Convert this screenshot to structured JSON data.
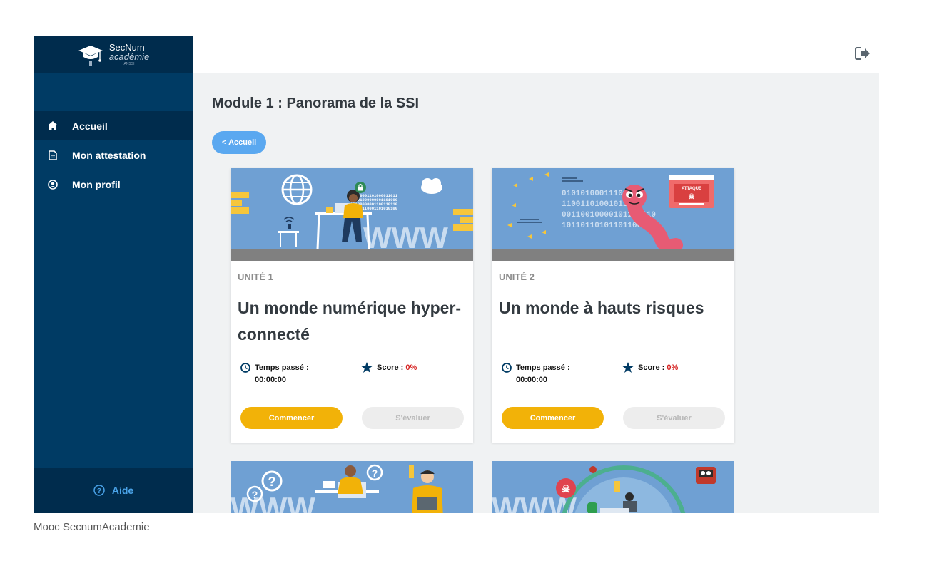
{
  "brand": {
    "line1": "SecNum",
    "line2": "académie",
    "line3": "ANSSI"
  },
  "sidebar": {
    "items": [
      {
        "label": "Accueil",
        "icon": "home-icon",
        "active": true
      },
      {
        "label": "Mon attestation",
        "icon": "document-icon",
        "active": false
      },
      {
        "label": "Mon profil",
        "icon": "user-circle-icon",
        "active": false
      }
    ],
    "help": {
      "label": "Aide",
      "icon": "help-circle-icon"
    }
  },
  "topbar": {
    "logout_icon": "logout-icon"
  },
  "page": {
    "title": "Module 1 : Panorama de la SSI",
    "back_label": "< Accueil"
  },
  "cards": [
    {
      "unit": "UNITÉ 1",
      "title": "Un monde numérique hyper-connecté",
      "time_label": "Temps passé :",
      "time_value": "00:00:00",
      "score_label": "Score :",
      "score_value": "0%",
      "start_label": "Commencer",
      "eval_label": "S'évaluer",
      "illustration_text": "WWW",
      "binary_lines": [
        "01100001101000011011",
        "11001000000001101000",
        "10100000001100110110",
        "01010110001101010100"
      ]
    },
    {
      "unit": "UNITÉ 2",
      "title": "Un monde à hauts risques",
      "time_label": "Temps passé :",
      "time_value": "00:00:00",
      "score_label": "Score :",
      "score_value": "0%",
      "start_label": "Commencer",
      "eval_label": "S'évaluer",
      "badge_text": "ATTAQUE",
      "binary_lines": [
        "01010100011101000",
        "11001101001011010",
        "00110010000101100110",
        "10110110101101100010"
      ]
    }
  ],
  "partial_cards": [
    {
      "illustration_text": "WWW"
    },
    {
      "illustration_text": "WWW"
    }
  ],
  "colors": {
    "sidebar": "#003b64",
    "accent_yellow": "#f2b208",
    "back_button": "#5aa8f0",
    "score_red": "#d6201f"
  },
  "caption": "Mooc SecnumAcademie"
}
